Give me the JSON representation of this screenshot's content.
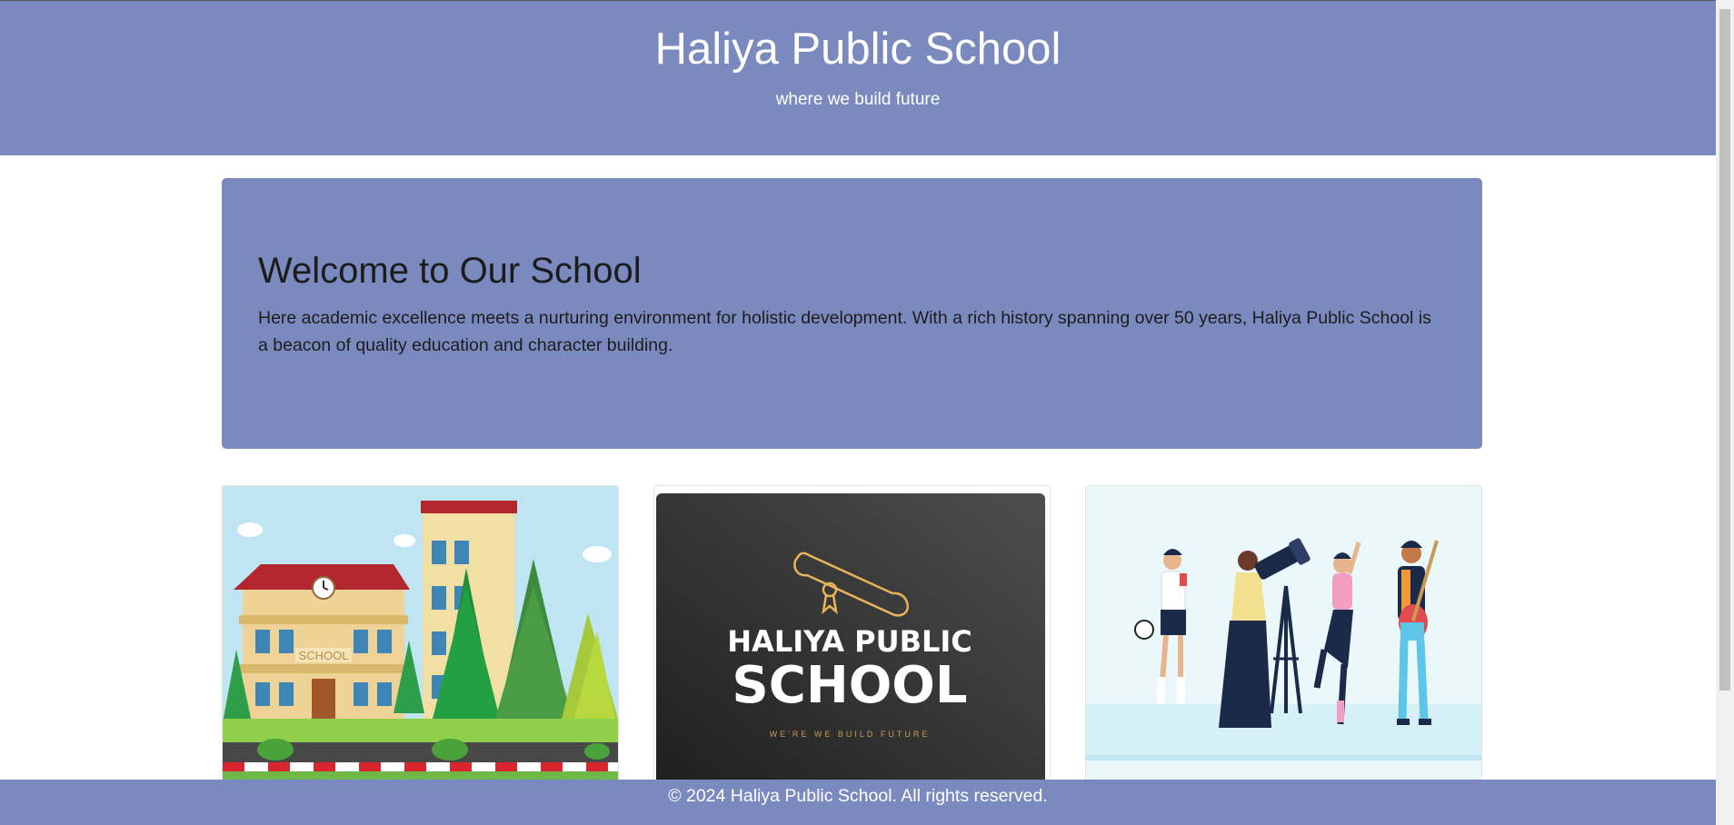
{
  "header": {
    "title": "Haliya Public School",
    "tagline": "where we build future"
  },
  "welcome": {
    "heading": "Welcome to Our School",
    "text": "Here academic excellence meets a nurturing environment for holistic development. With a rich history spanning over 50 years, Haliya Public School is a beacon of quality education and character building."
  },
  "cards": [
    {
      "image": "school-building-illustration",
      "sign": "SCHOOL"
    },
    {
      "image": "school-logo",
      "logo_line1": "HALIYA PUBLIC",
      "logo_line2": "SCHOOL",
      "logo_tagline": "WE'RE WE BUILD FUTURE"
    },
    {
      "image": "students-activities-illustration"
    }
  ],
  "footer": {
    "text": "© 2024 Haliya Public School. All rights reserved."
  },
  "colors": {
    "brand": "#7a8abf",
    "text_dark": "#1c1c1c",
    "white": "#ffffff"
  }
}
